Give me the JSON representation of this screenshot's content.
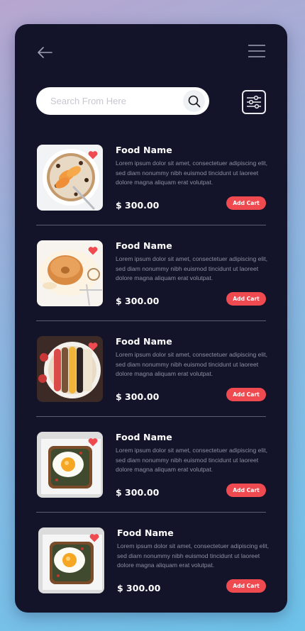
{
  "header": {
    "back_icon": "arrow-left-icon",
    "menu_icon": "hamburger-icon"
  },
  "search": {
    "placeholder": "Search From Here",
    "icon": "search-icon"
  },
  "filter": {
    "icon": "sliders-icon"
  },
  "colors": {
    "background": "#13142a",
    "accent": "#ee4a50",
    "text": "#ffffff",
    "muted": "#8e8fa0"
  },
  "items": [
    {
      "name": "Food Name",
      "description": "Lorem ipsum dolor sit amet, consectetuer adipiscing elit, sed diam nonummy nibh euismod tincidunt ut laoreet dolore magna aliquam erat volutpat.",
      "price": "$ 300.00",
      "button": "Add Cart",
      "image": "oatmeal-bowl-image"
    },
    {
      "name": "Food Name",
      "description": "Lorem ipsum dolor sit amet, consectetuer adipiscing elit, sed diam nonummy nibh euismod tincidunt ut laoreet dolore magna aliquam erat volutpat.",
      "price": "$ 300.00",
      "button": "Add Cart",
      "image": "bagel-plate-image"
    },
    {
      "name": "Food Name",
      "description": "Lorem ipsum dolor sit amet, consectetuer adipiscing elit, sed diam nonummy nibh euismod tincidunt ut laoreet dolore magna aliquam erat volutpat.",
      "price": "$ 300.00",
      "button": "Add Cart",
      "image": "smoothie-bowl-image"
    },
    {
      "name": "Food Name",
      "description": "Lorem ipsum dolor sit amet, consectetuer adipiscing elit, sed diam nonummy nibh euismod tincidunt ut laoreet dolore magna aliquam erat volutpat.",
      "price": "$ 300.00",
      "button": "Add Cart",
      "image": "egg-toast-image"
    },
    {
      "name": "Food Name",
      "description": "Lorem ipsum dolor sit amet, consectetuer adipiscing elit, sed diam nonummy nibh euismod tincidunt ut laoreet dolore magna aliquam erat volutpat.",
      "price": "$ 300.00",
      "button": "Add Cart",
      "image": "egg-toast-image"
    }
  ]
}
